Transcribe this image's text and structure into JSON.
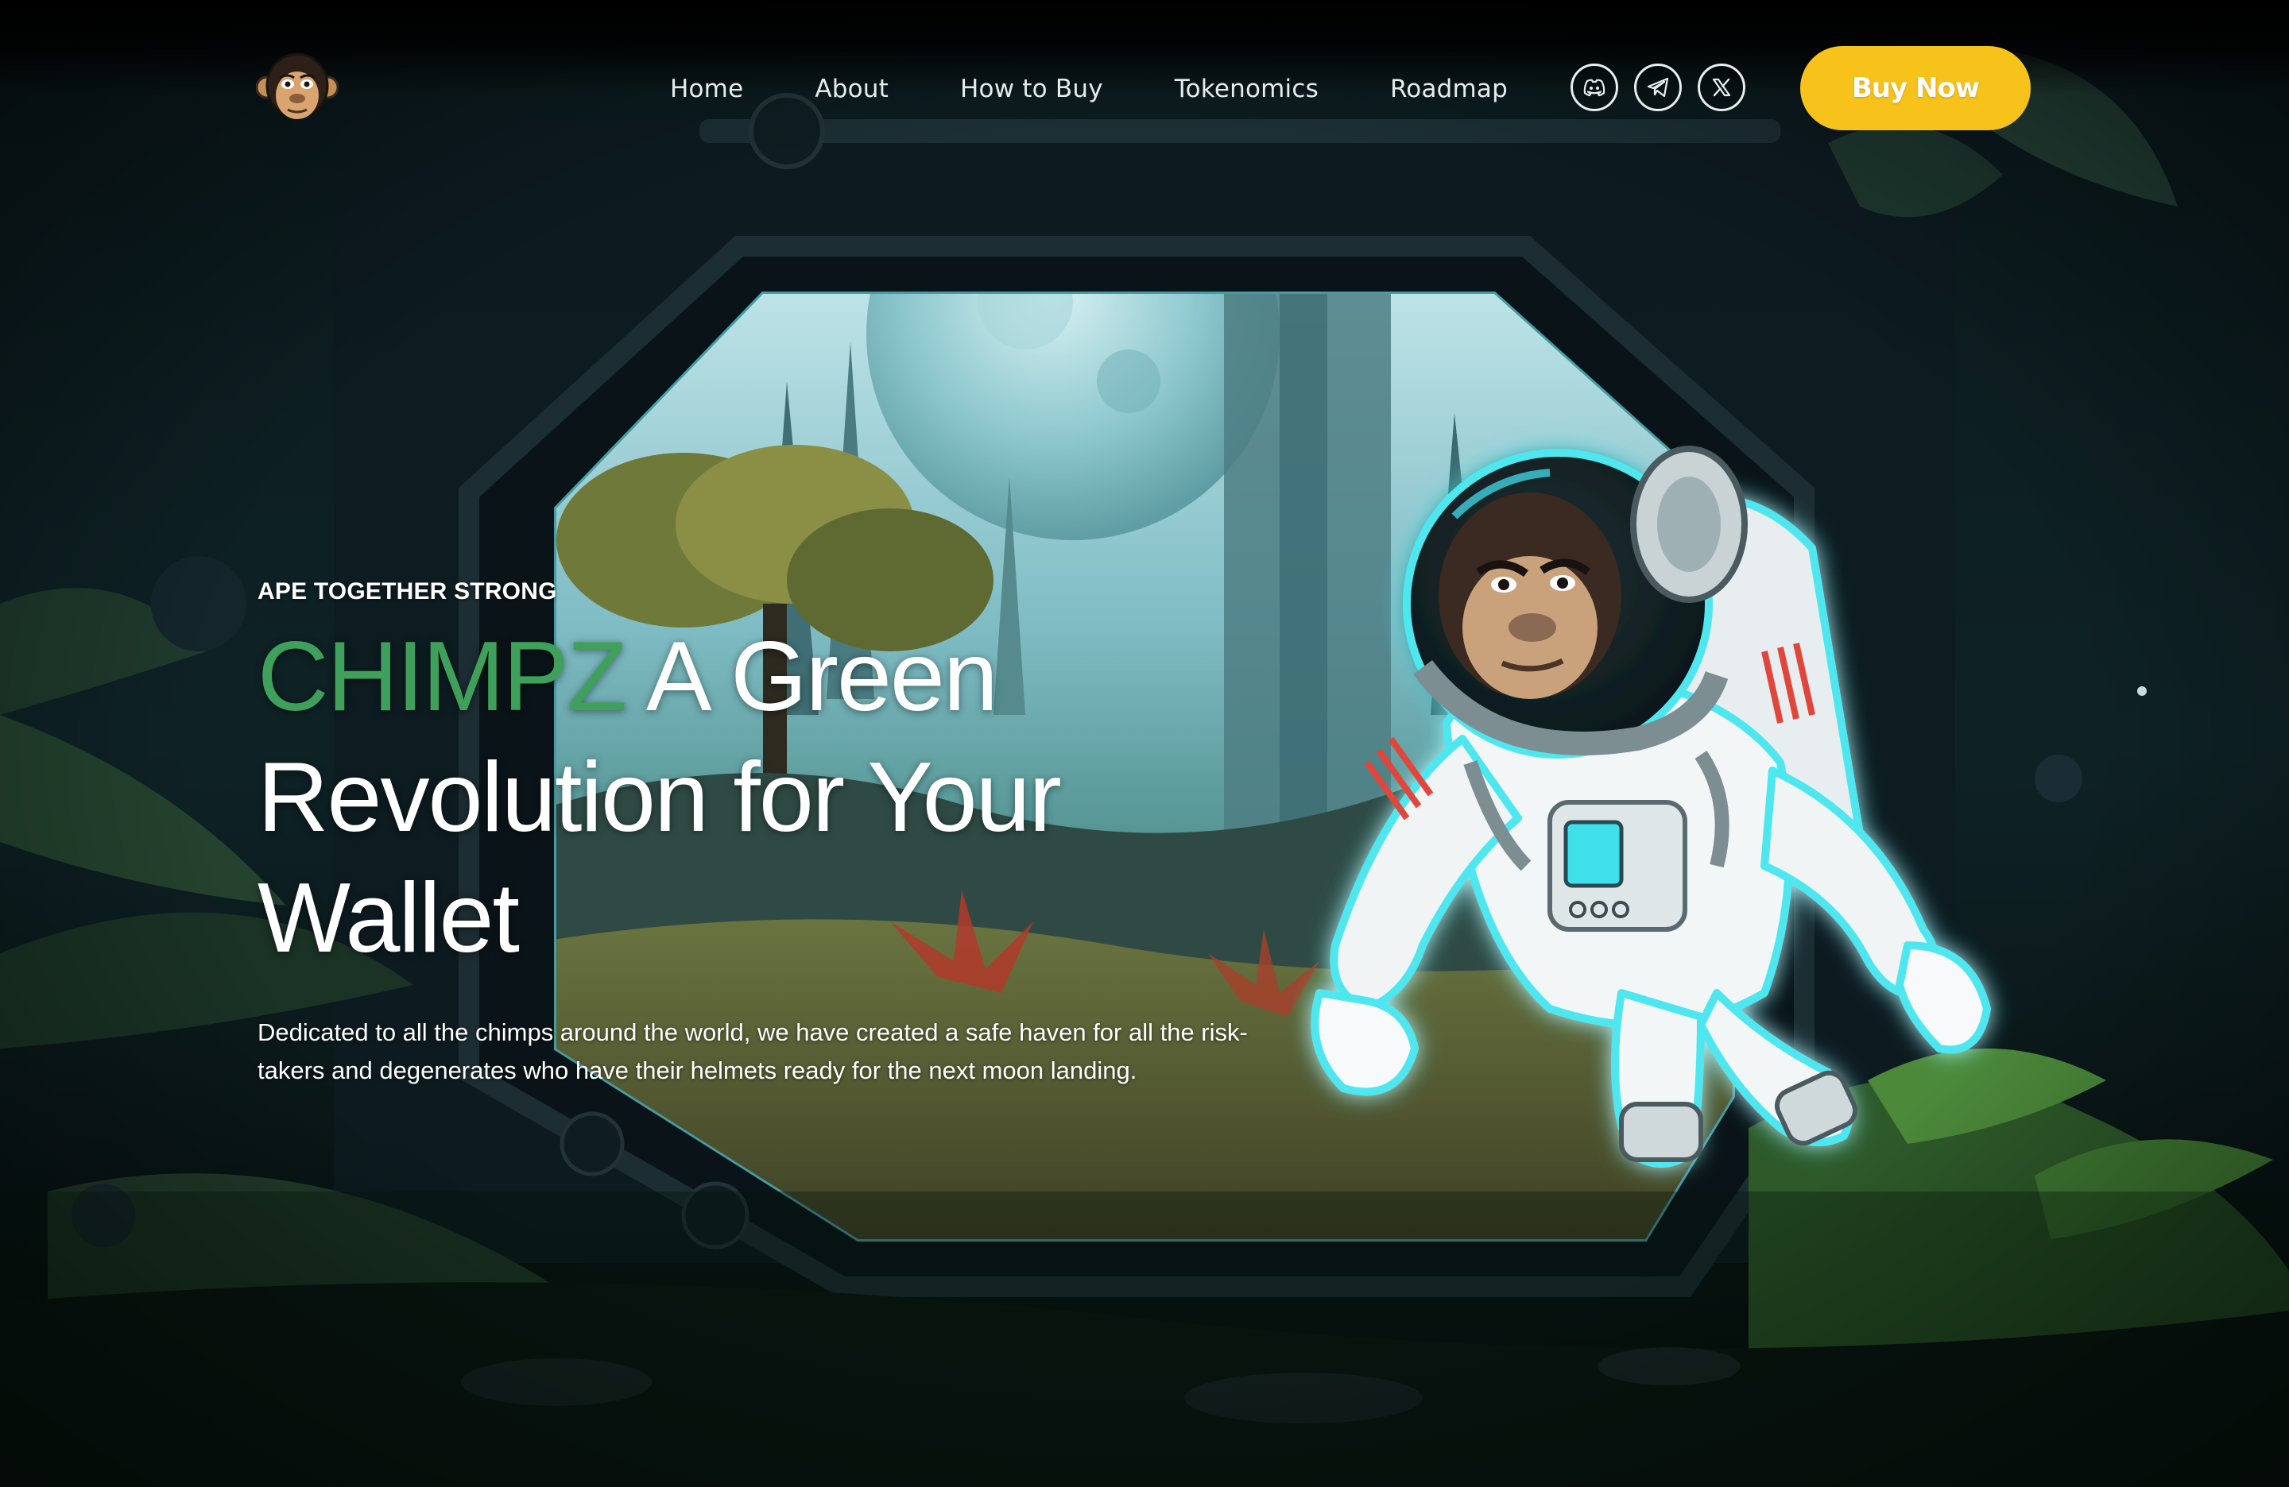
{
  "nav": {
    "logo_icon": "chimp-face-logo-icon",
    "links": [
      "Home",
      "About",
      "How to Buy",
      "Tokenomics",
      "Roadmap"
    ],
    "socials": [
      {
        "icon": "discord-icon"
      },
      {
        "icon": "telegram-icon"
      },
      {
        "icon": "x-twitter-icon"
      }
    ],
    "cta_label": "Buy Now"
  },
  "hero": {
    "tagline": "APE TOGETHER STRONG",
    "headline_brand": "CHIMPZ",
    "headline_rest": "A Green Revolution for Your Wallet",
    "description": "Dedicated to all the chimps around the world, we have created a safe haven for all the risk-takers and degenerates who have their helmets ready for the next moon landing.",
    "illustration_icon": "astronaut-chimp-illustration"
  },
  "colors": {
    "brand_green": "#3fa05c",
    "cta_yellow": "#f7c21a",
    "background_dark": "#070d10",
    "text_white": "#ffffff",
    "glow_cyan": "#4fe7ef"
  }
}
